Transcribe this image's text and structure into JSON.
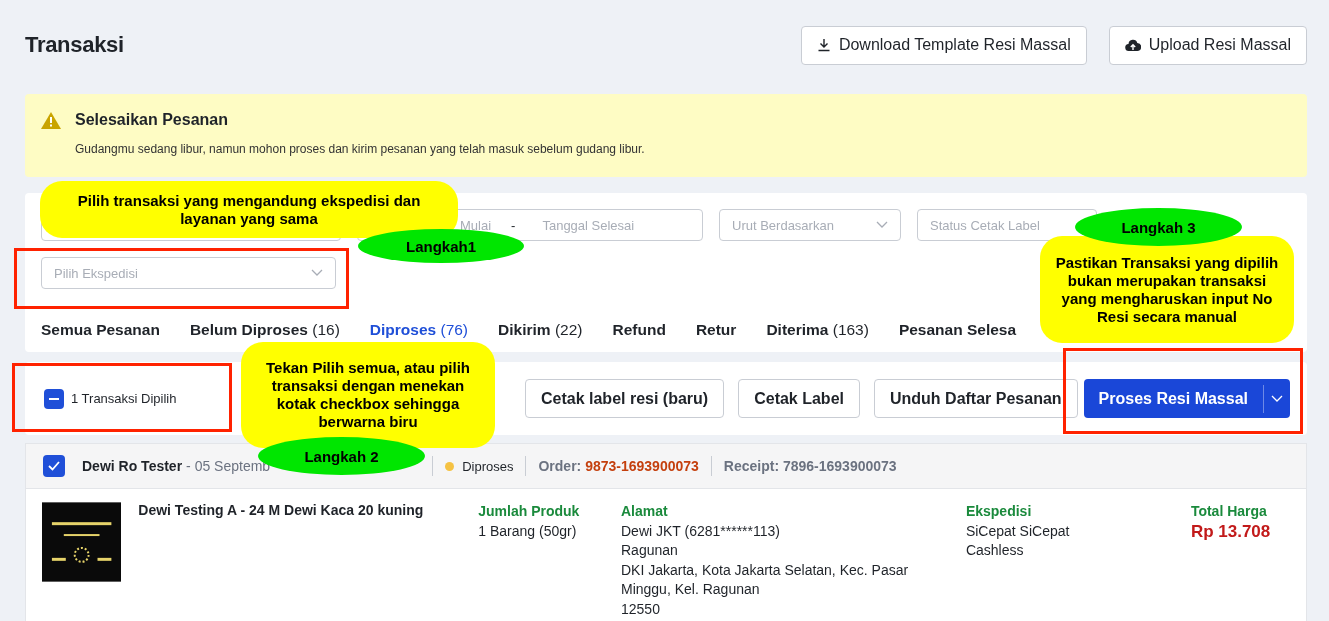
{
  "header": {
    "title": "Transaksi",
    "buttons": [
      {
        "kind": "download",
        "label": "Download Template Resi Massal"
      },
      {
        "kind": "upload",
        "label": "Upload Resi Massal"
      }
    ]
  },
  "alert": {
    "title": "Selesaikan Pesanan",
    "message": "Gudangmu sedang libur, namun mohon proses dan kirim pesanan yang telah masuk sebelum gudang libur."
  },
  "filters": {
    "date_start": {
      "placeholder": "Mulai"
    },
    "date_separator": "-",
    "date_end": {
      "placeholder": "Tanggal Selesai"
    },
    "sort": {
      "placeholder": "Urut Berdasarkan"
    },
    "label_status": {
      "placeholder": "Status Cetak Label"
    },
    "courier": {
      "placeholder": "Pilih Ekspedisi"
    }
  },
  "tabs": [
    {
      "label": "Semua Pesanan",
      "selected": false
    },
    {
      "label": "Belum Diproses",
      "count": "(16)",
      "selected": false
    },
    {
      "label": "Diproses",
      "count": "(76)",
      "selected": true
    },
    {
      "label": "Dikirim",
      "count": "(22)",
      "selected": false
    },
    {
      "label": "Refund",
      "selected": false
    },
    {
      "label": "Retur",
      "selected": false
    },
    {
      "label": "Diterima",
      "count": "(163)",
      "selected": false
    },
    {
      "label": "Pesanan Selesa",
      "selected": false
    }
  ],
  "selection": {
    "label": "1 Transaksi Dipilih",
    "indeterminate": true
  },
  "actions": [
    "Cetak label resi (baru)",
    "Cetak Label",
    "Unduh Daftar Pesanan"
  ],
  "primary_action": {
    "label": "Proses Resi Massal"
  },
  "order": {
    "selected": true,
    "customer": "Dewi Ro Tester",
    "date": "- 05 Septemb",
    "status": {
      "label": "Diproses",
      "color": "#f5c243"
    },
    "order_label": "Order:",
    "order_number": "9873-1693900073",
    "receipt": "Receipt: 7896-1693900073",
    "product": {
      "name": "Dewi Testing A - 24 M Dewi Kaca 20 kuning"
    },
    "details": [
      {
        "heading": "Jumlah Produk",
        "lines": [
          "1 Barang (50gr)"
        ]
      },
      {
        "heading": "Alamat",
        "lines": [
          "Dewi JKT (6281******113)",
          "Ragunan",
          "DKI Jakarta, Kota Jakarta Selatan, Kec. Pasar Minggu, Kel. Ragunan",
          "12550"
        ]
      },
      {
        "heading": "Ekspedisi",
        "lines": [
          "SiCepat SiCepat",
          "Cashless"
        ]
      }
    ],
    "total": {
      "heading": "Total Harga",
      "value": "Rp 13.708"
    }
  },
  "annotations": {
    "callouts": [
      "Pilih transaksi yang mengandung ekspedisi dan layanan yang sama",
      "Pastikan Transaksi yang dipilih bukan merupakan transaksi yang mengharuskan input No Resi secara manual",
      "Tekan Pilih semua, atau pilih transaksi dengan menekan kotak checkbox sehingga berwarna biru"
    ],
    "steps": [
      "Langkah1",
      "Langkah 3",
      "Langkah 2"
    ]
  }
}
